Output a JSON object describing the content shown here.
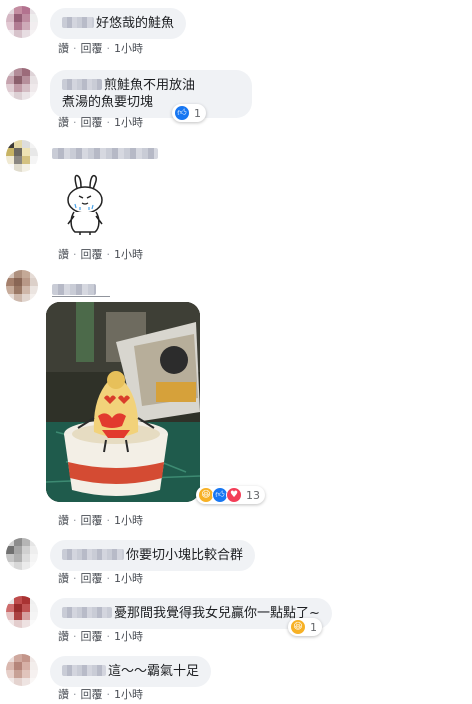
{
  "actions": {
    "like": "讚",
    "reply": "回覆",
    "separator": "·",
    "time": "1小時"
  },
  "comments": [
    {
      "text": "好悠哉的鮭魚"
    },
    {
      "text_line1": "煎鮭魚不用放油",
      "text_line2": "煮湯的魚要切塊",
      "reaction_count": "1"
    },
    {
      "attachment": "sticker-rabbit"
    },
    {
      "attachment": "photo-egg-bikini-cup",
      "reaction_count": "13"
    },
    {
      "text": "你要切小塊比較合群"
    },
    {
      "text": "憂那間我覺得我女兒贏你一點點了~",
      "reaction_count": "1"
    },
    {
      "text": "這～～霸氣十足"
    }
  ],
  "colors": {
    "bubble": "#f0f2f5",
    "like_blue": "#1877f2",
    "love_red": "#f33e58",
    "haha_yellow": "#f7b125"
  }
}
